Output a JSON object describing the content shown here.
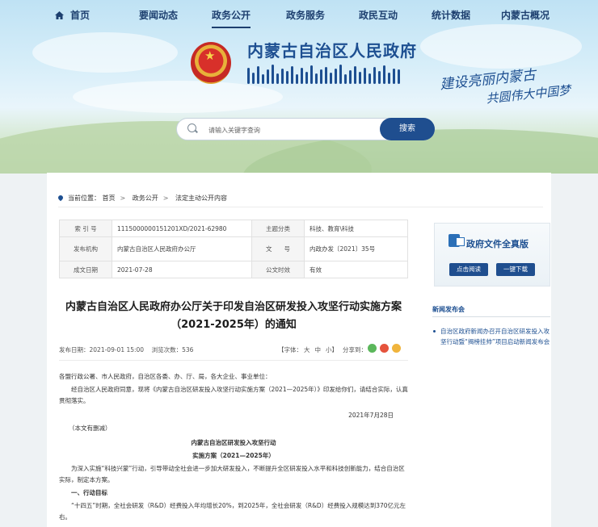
{
  "nav": {
    "items": [
      "首页",
      "要闻动态",
      "政务公开",
      "政务服务",
      "政民互动",
      "统计数据",
      "内蒙古概况"
    ],
    "active": "政务公开"
  },
  "header": {
    "title": "内蒙古自治区人民政府",
    "slogan_line1": "建设亮丽内蒙古",
    "slogan_line2": "共圆伟大中国梦"
  },
  "search": {
    "placeholder": "请输入关键字查询",
    "button": "搜索"
  },
  "breadcrumb": {
    "label": "当前位置：",
    "items": [
      "首页",
      "政务公开",
      "法定主动公开内容"
    ]
  },
  "meta": {
    "rows": [
      [
        "索 引 号",
        "1115000000151201XD/2021-62980",
        "主题分类",
        "科技、教育\\科技"
      ],
      [
        "发布机构",
        "内蒙古自治区人民政府办公厅",
        "文　　号",
        "内政办发〔2021〕35号"
      ],
      [
        "成文日期",
        "2021-07-28",
        "公文时效",
        "有效"
      ]
    ]
  },
  "doc": {
    "title": "内蒙古自治区人民政府办公厅关于印发自治区研发投入攻坚行动实施方案（2021-2025年）的通知",
    "publish": "发布日期：2021-09-01 15:00",
    "views": "浏览次数：536",
    "font_label": "【字体：",
    "font_large": "大",
    "font_medium": "中",
    "font_small": "小】",
    "share_label": "分享到：",
    "salutation": "各盟行政公署、市人民政府，自治区各委、办、厅、局，各大企业、事业单位：",
    "body1": "经自治区人民政府同意，现将《内蒙古自治区研发投入攻坚行动实施方案（2021—2025年）》印发给你们，请结合实际，认真贯彻落实。",
    "date": "2021年7月28日",
    "note": "（本文有删减）",
    "sub1": "内蒙古自治区研发投入攻坚行动",
    "sub2": "实施方案（2021—2025年）",
    "body2": "为深入实施“科技兴蒙”行动，引导带动全社会进一步加大研发投入，不断提升全区研发投入水平和科技创新能力，结合自治区实际，制定本方案。",
    "section1": "一、行动目标",
    "body3": "“十四五”时期，全社会研发（R&D）经费投入年均增长20%，到2025年，全社会研发（R&D）经费投入规模达到370亿元左右。"
  },
  "side": {
    "title": "政府文件全真版",
    "btn_read": "点击阅读",
    "btn_download": "一键下载",
    "news_head": "新闻发布会",
    "news_item": "自治区政府新闻办召开自治区研发投入攻坚行动暨“揭榜挂帅”项目启动新闻发布会"
  },
  "colors": {
    "brand": "#1d4f91",
    "button": "#1f4e8f"
  }
}
